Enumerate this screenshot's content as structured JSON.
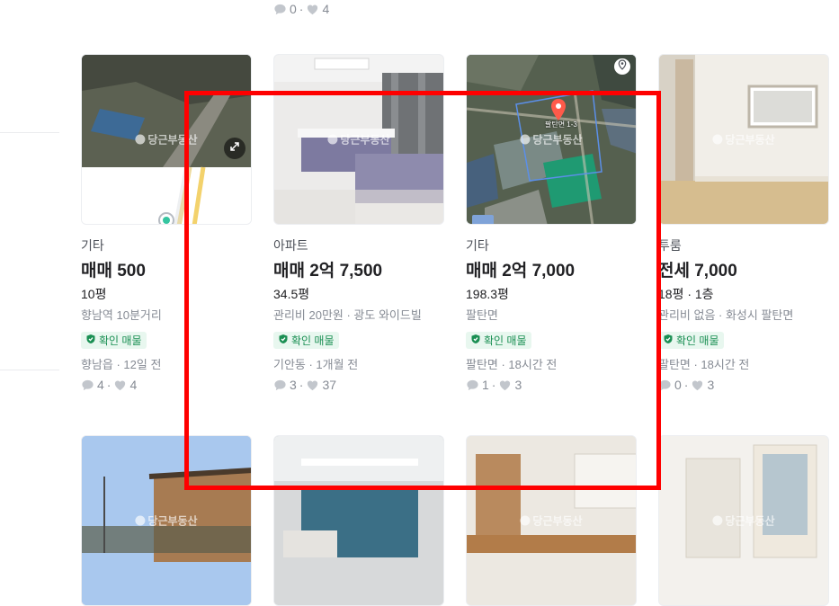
{
  "top_listing": {
    "comments": "0",
    "likes": "4"
  },
  "listings": [
    {
      "category": "기타",
      "price": "매매 500",
      "area": "10평",
      "desc": "향남역 10분거리",
      "badge": "확인 매물",
      "meta": "향남읍 · 12일 전",
      "comments": "4",
      "likes": "4",
      "watermark": "당근부동산"
    },
    {
      "category": "아파트",
      "price": "매매 2억 7,500",
      "area": "34.5평",
      "desc": "관리비 20만원 · 광도 와이드빌",
      "badge": "확인 매물",
      "meta": "기안동 · 1개월 전",
      "comments": "3",
      "likes": "37",
      "watermark": "당근부동산"
    },
    {
      "category": "기타",
      "price": "매매 2억 7,000",
      "area": "198.3평",
      "desc": "팔탄면",
      "badge": "확인 매물",
      "meta": "팔탄면 · 18시간 전",
      "comments": "1",
      "likes": "3",
      "watermark": "당근부동산",
      "map_label": "팔탄면 1-3"
    },
    {
      "category": "투룸",
      "price": "전세 7,000",
      "area": "18평 · 1층",
      "desc": "관리비 없음 · 화성시 팔탄면",
      "badge": "확인 매물",
      "meta": "팔탄면 · 18시간 전",
      "comments": "0",
      "likes": "3",
      "watermark": "당근부동산"
    }
  ],
  "second_row": [
    {
      "watermark": "당근부동산"
    },
    {
      "watermark": ""
    },
    {
      "watermark": "당근부동산"
    },
    {
      "watermark": "당근부동산"
    }
  ],
  "colors": {
    "highlight": "#ff0000",
    "badge_bg": "#e8f7ef",
    "badge_text": "#1a8f53",
    "muted": "#868b94"
  }
}
